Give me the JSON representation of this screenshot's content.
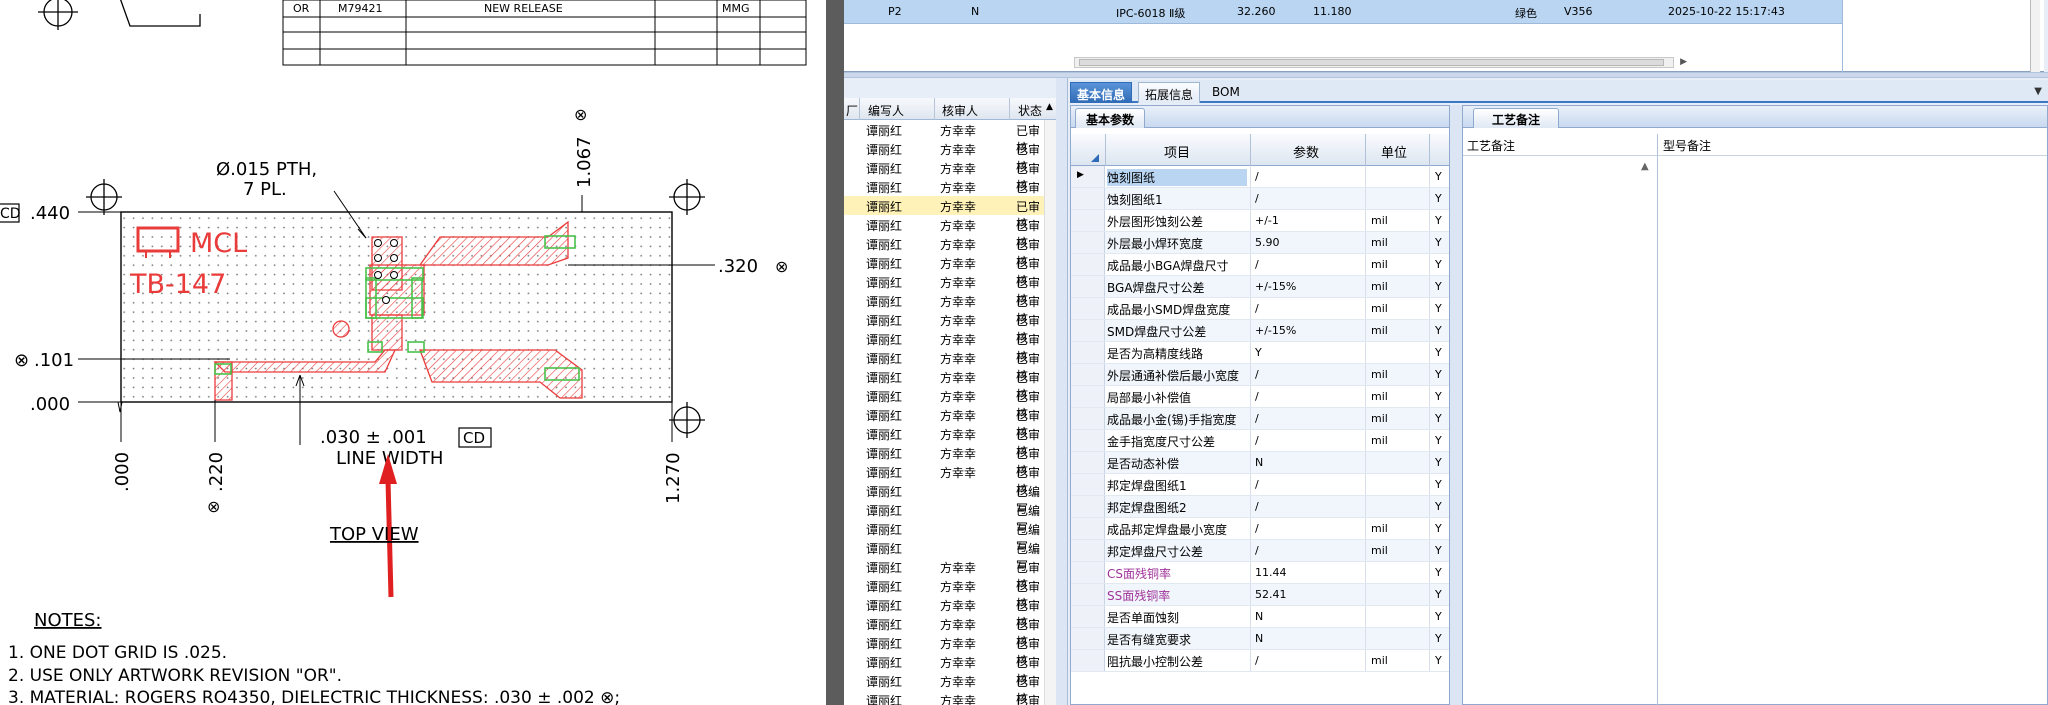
{
  "drawing": {
    "title_row": {
      "rev": "OR",
      "number": "M79421",
      "desc": "NEW RELEASE",
      "by": "MMG"
    },
    "dims": {
      "d440": ".440",
      "d101": ".101",
      "d000_left": ".000",
      "d320": ".320",
      "d1067": "1.067",
      "d000_bottom": ".000",
      "d220": ".220",
      "d1270": "1.270",
      "cd_left": "CD",
      "cd_mid": "CD"
    },
    "callout_pth": "Ø.015 PTH,",
    "callout_pl": "7 PL.",
    "line_width_value": ".030 ± .001",
    "line_width_label": "LINE WIDTH",
    "logo_text": "MCL",
    "part_text": "TB-147",
    "view_label": "TOP VIEW",
    "notes_title": "NOTES:",
    "notes": [
      "1. ONE DOT GRID IS .025.",
      "2. USE ONLY ARTWORK REVISION \"OR\".",
      "3. MATERIAL: ROGERS RO4350, DIELECTRIC THICKNESS: .030 ± .002 ⊗;"
    ],
    "colors": {
      "red": "#ea3b3b",
      "green": "#48c24a"
    }
  },
  "top_row": {
    "c1": "P2",
    "c2": "N",
    "c3": "IPC-6018 Ⅱ级",
    "c4": "32.260",
    "c5": "11.180",
    "c6": "绿色",
    "c7": "V356",
    "c8": "2025-10-22 15:17:43"
  },
  "list": {
    "headers": [
      "厂",
      "编写人",
      "核审人",
      "状态"
    ],
    "rows": [
      [
        "谭丽红",
        "方幸幸",
        "已审核"
      ],
      [
        "谭丽红",
        "方幸幸",
        "已审核"
      ],
      [
        "谭丽红",
        "方幸幸",
        "已审核"
      ],
      [
        "谭丽红",
        "方幸幸",
        "已审核"
      ],
      [
        "谭丽红",
        "方幸幸",
        "已审核"
      ],
      [
        "谭丽红",
        "方幸幸",
        "已审核"
      ],
      [
        "谭丽红",
        "方幸幸",
        "已审核"
      ],
      [
        "谭丽红",
        "方幸幸",
        "已审核"
      ],
      [
        "谭丽红",
        "方幸幸",
        "已审核"
      ],
      [
        "谭丽红",
        "方幸幸",
        "已审核"
      ],
      [
        "谭丽红",
        "方幸幸",
        "已审核"
      ],
      [
        "谭丽红",
        "方幸幸",
        "已审核"
      ],
      [
        "谭丽红",
        "方幸幸",
        "已审核"
      ],
      [
        "谭丽红",
        "方幸幸",
        "已审核"
      ],
      [
        "谭丽红",
        "方幸幸",
        "已审核"
      ],
      [
        "谭丽红",
        "方幸幸",
        "已审核"
      ],
      [
        "谭丽红",
        "方幸幸",
        "已审核"
      ],
      [
        "谭丽红",
        "方幸幸",
        "已审核"
      ],
      [
        "谭丽红",
        "方幸幸",
        "已审核"
      ],
      [
        "谭丽红",
        "",
        "已编写"
      ],
      [
        "谭丽红",
        "",
        "已编写"
      ],
      [
        "谭丽红",
        "",
        "已编写"
      ],
      [
        "谭丽红",
        "",
        "已编写"
      ],
      [
        "谭丽红",
        "方幸幸",
        "已审核"
      ],
      [
        "谭丽红",
        "方幸幸",
        "已审核"
      ],
      [
        "谭丽红",
        "方幸幸",
        "已审核"
      ],
      [
        "谭丽红",
        "方幸幸",
        "已审核"
      ],
      [
        "谭丽红",
        "方幸幸",
        "已审核"
      ],
      [
        "谭丽红",
        "方幸幸",
        "已审核"
      ],
      [
        "谭丽红",
        "方幸幸",
        "已审核"
      ],
      [
        "谭丽红",
        "方幸幸",
        "已审核"
      ]
    ],
    "highlight_index": 4,
    "highlight_color": "#fff2b8"
  },
  "tabs": [
    "基本信息",
    "拓展信息",
    "BOM"
  ],
  "params": {
    "panel_title": "基本参数",
    "headers": [
      "项目",
      "参数",
      "单位"
    ],
    "rows": [
      {
        "item": "蚀刻图纸",
        "value": "/",
        "unit": "",
        "flag": "Y"
      },
      {
        "item": "蚀刻图纸1",
        "value": "/",
        "unit": "",
        "flag": "Y"
      },
      {
        "item": "外层图形蚀刻公差",
        "value": "+/-1",
        "unit": "mil",
        "flag": "Y"
      },
      {
        "item": "外层最小焊环宽度",
        "value": "5.90",
        "unit": "mil",
        "flag": "Y"
      },
      {
        "item": "成品最小BGA焊盘尺寸",
        "value": "/",
        "unit": "mil",
        "flag": "Y"
      },
      {
        "item": "BGA焊盘尺寸公差",
        "value": "+/-15%",
        "unit": "mil",
        "flag": "Y"
      },
      {
        "item": "成品最小SMD焊盘宽度",
        "value": "/",
        "unit": "mil",
        "flag": "Y"
      },
      {
        "item": "SMD焊盘尺寸公差",
        "value": "+/-15%",
        "unit": "mil",
        "flag": "Y"
      },
      {
        "item": "是否为高精度线路",
        "value": "Y",
        "unit": "",
        "flag": "Y"
      },
      {
        "item": "外层通通补偿后最小宽度",
        "value": "/",
        "unit": "mil",
        "flag": "Y"
      },
      {
        "item": "局部最小补偿值",
        "value": "/",
        "unit": "mil",
        "flag": "Y"
      },
      {
        "item": "成品最小金(锡)手指宽度",
        "value": "/",
        "unit": "mil",
        "flag": "Y"
      },
      {
        "item": "金手指宽度尺寸公差",
        "value": "/",
        "unit": "mil",
        "flag": "Y"
      },
      {
        "item": "是否动态补偿",
        "value": "N",
        "unit": "",
        "flag": "Y"
      },
      {
        "item": "邦定焊盘图纸1",
        "value": "/",
        "unit": "",
        "flag": "Y"
      },
      {
        "item": "邦定焊盘图纸2",
        "value": "/",
        "unit": "",
        "flag": "Y"
      },
      {
        "item": "成品邦定焊盘最小宽度",
        "value": "/",
        "unit": "mil",
        "flag": "Y"
      },
      {
        "item": "邦定焊盘尺寸公差",
        "value": "/",
        "unit": "mil",
        "flag": "Y"
      },
      {
        "item": "CS面残铜率",
        "value": "11.44",
        "unit": "",
        "flag": "Y",
        "purple": true
      },
      {
        "item": "SS面残铜率",
        "value": "52.41",
        "unit": "",
        "flag": "Y",
        "purple": true
      },
      {
        "item": "是否单面蚀刻",
        "value": "N",
        "unit": "",
        "flag": "Y"
      },
      {
        "item": "是否有缝宽要求",
        "value": "N",
        "unit": "",
        "flag": "Y"
      },
      {
        "item": "阻抗最小控制公差",
        "value": "/",
        "unit": "mil",
        "flag": "Y"
      }
    ]
  },
  "remarks": {
    "panel_title": "工艺备注",
    "col1": "工艺备注",
    "col2": "型号备注"
  }
}
